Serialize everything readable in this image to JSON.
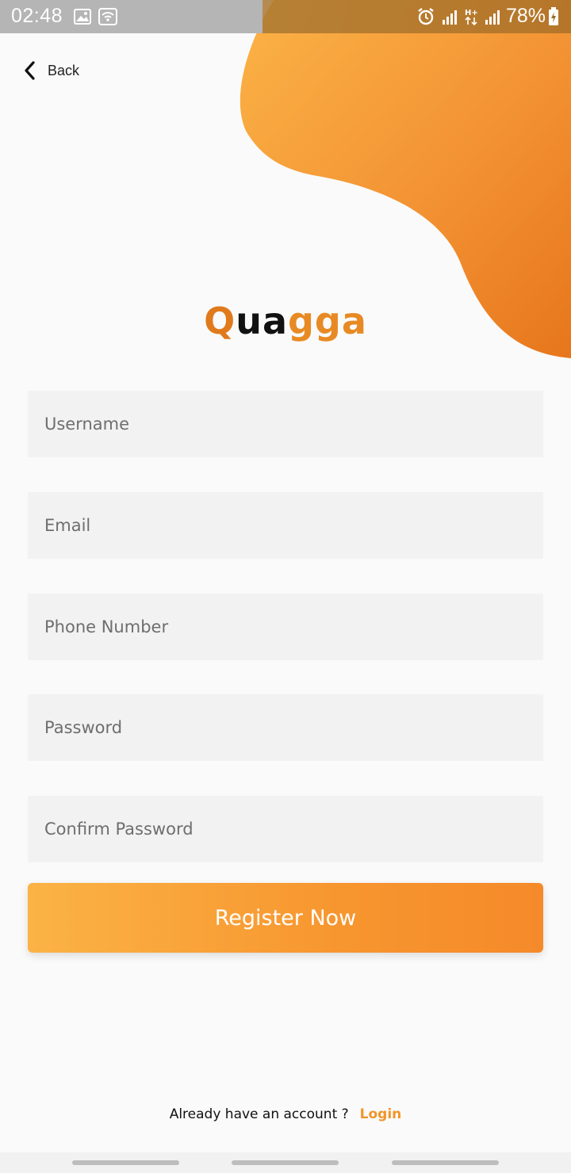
{
  "status_bar": {
    "time": "02:48",
    "battery": "78%",
    "icons": [
      "gallery-icon",
      "wifi-icon",
      "alarm-icon",
      "signal-icon",
      "data-hplus-icon",
      "signal-icon",
      "battery-charging-icon"
    ]
  },
  "header": {
    "back_label": "Back"
  },
  "logo": {
    "part1": "Q",
    "part2": "ua",
    "part3": "gga"
  },
  "form": {
    "username_placeholder": "Username",
    "email_placeholder": "Email",
    "phone_placeholder": "Phone Number",
    "password_placeholder": "Password",
    "confirm_placeholder": "Confirm Password",
    "register_label": "Register Now"
  },
  "footer": {
    "question": "Already have an account ?",
    "login_label": "Login"
  },
  "colors": {
    "accent": "#f58a2a",
    "accent_light": "#fbb346",
    "logo_orange": "#e07a1c"
  }
}
